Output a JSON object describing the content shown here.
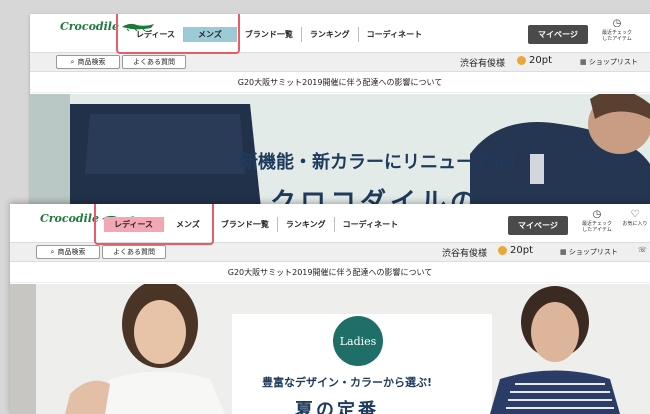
{
  "back": {
    "logo": "Crocodile",
    "nav": [
      "レディース",
      "メンズ",
      "ブランド一覧",
      "ランキング",
      "コーディネート"
    ],
    "mypage": "マイページ",
    "recent_label": "最近チェック\nしたアイテム",
    "search_label": "商品検索",
    "faq_label": "よくある質問",
    "user": "渋谷有俊様",
    "points": "20pt",
    "shoplist": "ショップリスト",
    "notice": "G20大阪サミット2019開催に伴う配達への影響について",
    "hero_line1": "新機能・新カラーにリニューアル!",
    "hero_line2": "クロコダイルの"
  },
  "front": {
    "logo": "Crocodile",
    "nav": [
      "レディース",
      "メンズ",
      "ブランド一覧",
      "ランキング",
      "コーディネート"
    ],
    "mypage": "マイページ",
    "recent_label": "最近チェック\nしたアイテム",
    "favorite_label": "お気に入り",
    "search_label": "商品検索",
    "faq_label": "よくある質問",
    "user": "渋谷有俊様",
    "points": "20pt",
    "shoplist": "ショップリスト",
    "notice": "G20大阪サミット2019開催に伴う配達への影響について",
    "badge": "Ladies",
    "hero_line1": "豊富なデザイン・カラーから選ぶ!",
    "hero_line2": "夏の定番"
  },
  "colors": {
    "brand_green": "#1d7a3a",
    "active_blue": "#9ccbd8",
    "active_pink": "#f3a6b4",
    "highlight": "#e85c6a",
    "badge_teal": "#1f6f68",
    "title_navy": "#1e3a5c"
  }
}
